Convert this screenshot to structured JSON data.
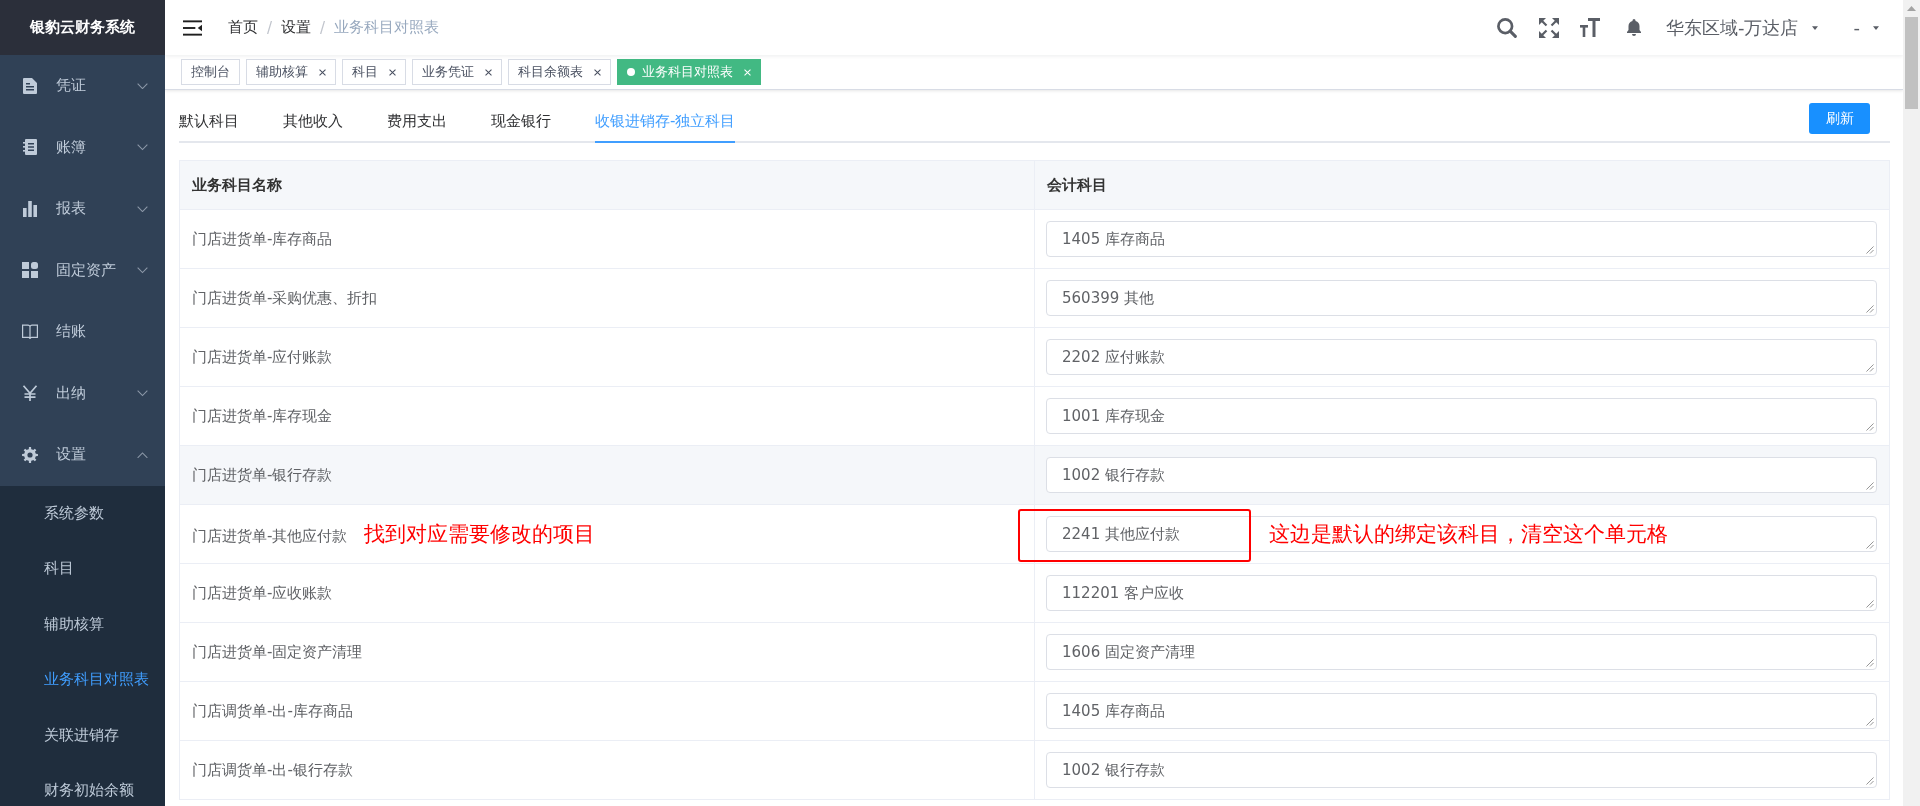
{
  "sidebar": {
    "title": "银豹云财务系统",
    "items": [
      {
        "label": "凭证",
        "kind": "group",
        "expanded": false
      },
      {
        "label": "账簿",
        "kind": "group",
        "expanded": false
      },
      {
        "label": "报表",
        "kind": "group",
        "expanded": false
      },
      {
        "label": "固定资产",
        "kind": "group",
        "expanded": false
      },
      {
        "label": "结账",
        "kind": "link"
      },
      {
        "label": "出纳",
        "kind": "group",
        "expanded": false
      },
      {
        "label": "设置",
        "kind": "group",
        "expanded": true,
        "children": [
          {
            "label": "系统参数",
            "selected": false
          },
          {
            "label": "科目",
            "selected": false
          },
          {
            "label": "辅助核算",
            "selected": false
          },
          {
            "label": "业务科目对照表",
            "selected": true
          },
          {
            "label": "关联进销存",
            "selected": false
          },
          {
            "label": "财务初始余额",
            "selected": false
          }
        ]
      }
    ]
  },
  "navbar": {
    "breadcrumb": {
      "separator": "/",
      "items": [
        "首页",
        "设置",
        "业务科目对照表"
      ]
    },
    "region": "华东区域-万达店",
    "user": "-"
  },
  "tags": [
    {
      "label": "控制台",
      "closable": false,
      "selected": false
    },
    {
      "label": "辅助核算",
      "closable": true,
      "selected": false
    },
    {
      "label": "科目",
      "closable": true,
      "selected": false
    },
    {
      "label": "业务凭证",
      "closable": true,
      "selected": false
    },
    {
      "label": "科目余额表",
      "closable": true,
      "selected": false
    },
    {
      "label": "业务科目对照表",
      "closable": true,
      "selected": true
    }
  ],
  "tabs": [
    {
      "label": "默认科目",
      "selected": false
    },
    {
      "label": "其他收入",
      "selected": false
    },
    {
      "label": "费用支出",
      "selected": false
    },
    {
      "label": "现金银行",
      "selected": false
    },
    {
      "label": "收银进销存-独立科目",
      "selected": true
    }
  ],
  "refresh_button": "刷新",
  "table": {
    "columns": [
      "业务科目名称",
      "会计科目"
    ],
    "rows": [
      {
        "name": "门店进货单-库存商品",
        "account": "1405 库存商品",
        "hovered": false,
        "outlined": false
      },
      {
        "name": "门店进货单-采购优惠、折扣",
        "account": "560399 其他",
        "hovered": false,
        "outlined": false
      },
      {
        "name": "门店进货单-应付账款",
        "account": "2202 应付账款",
        "hovered": false,
        "outlined": false
      },
      {
        "name": "门店进货单-库存现金",
        "account": "1001 库存现金",
        "hovered": false,
        "outlined": false
      },
      {
        "name": "门店进货单-银行存款",
        "account": "1002 银行存款",
        "hovered": true,
        "outlined": false
      },
      {
        "name": "门店进货单-其他应付款",
        "name_annotation": "找到对应需要修改的项目",
        "account": "2241 其他应付款",
        "account_annotation": "这边是默认的绑定该科目，清空这个单元格",
        "hovered": false,
        "outlined": true
      },
      {
        "name": "门店进货单-应收账款",
        "account": "112201 客户应收",
        "hovered": false,
        "outlined": false
      },
      {
        "name": "门店进货单-固定资产清理",
        "account": "1606 固定资产清理",
        "hovered": false,
        "outlined": false
      },
      {
        "name": "门店调货单-出-库存商品",
        "account": "1405 库存商品",
        "hovered": false,
        "outlined": false
      },
      {
        "name": "门店调货单-出-银行存款",
        "account": "1002 银行存款",
        "hovered": false,
        "outlined": false
      }
    ]
  }
}
